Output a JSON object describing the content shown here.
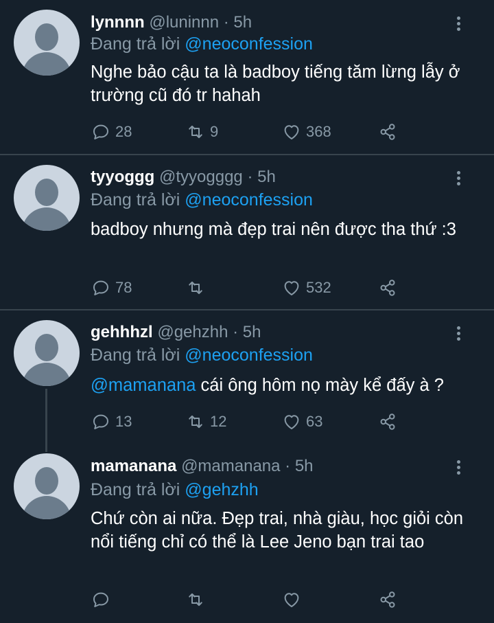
{
  "tweets": [
    {
      "name": "lynnnn",
      "handle": "@luninnn",
      "time": "· 5h",
      "reply_prefix": "Đang trả lời",
      "reply_to": "@neoconfession",
      "text": "Nghe bảo cậu ta là badboy tiếng tăm lừng lẫy ở trường cũ đó tr hahah",
      "replies": "28",
      "retweets": "9",
      "likes": "368"
    },
    {
      "name": "tyyoggg",
      "handle": "@tyyogggg",
      "time": "· 5h",
      "reply_prefix": "Đang trả lời",
      "reply_to": "@neoconfession",
      "text": "badboy nhưng mà đẹp trai nên được tha thứ :3",
      "replies": "78",
      "retweets": "",
      "likes": "532"
    },
    {
      "name": "gehhhzl",
      "handle": "@gehzhh",
      "time": "· 5h",
      "reply_prefix": "Đang trả lời",
      "reply_to": "@neoconfession",
      "text_mention": "@mamanana",
      "text": " cái ông hôm nọ mày kể đấy à ?",
      "replies": "13",
      "retweets": "12",
      "likes": "63"
    },
    {
      "name": "mamanana",
      "handle": "@mamanana",
      "time": "· 5h",
      "reply_prefix": "Đang trả lời",
      "reply_to": "@gehzhh",
      "text": "Chứ còn ai nữa. Đẹp trai, nhà giàu, học giỏi còn nổi tiếng chỉ có thể là Lee Jeno bạn trai tao",
      "replies": "",
      "retweets": "",
      "likes": ""
    }
  ],
  "icons": {
    "reply": "reply-icon",
    "retweet": "retweet-icon",
    "like": "heart-icon",
    "share": "share-icon",
    "more": "more-vertical-icon",
    "avatar": "default-avatar-icon"
  },
  "colors": {
    "background": "#15202b",
    "divider": "#38444d",
    "text": "#ffffff",
    "muted": "#8899a6",
    "link": "#1da1f2"
  }
}
